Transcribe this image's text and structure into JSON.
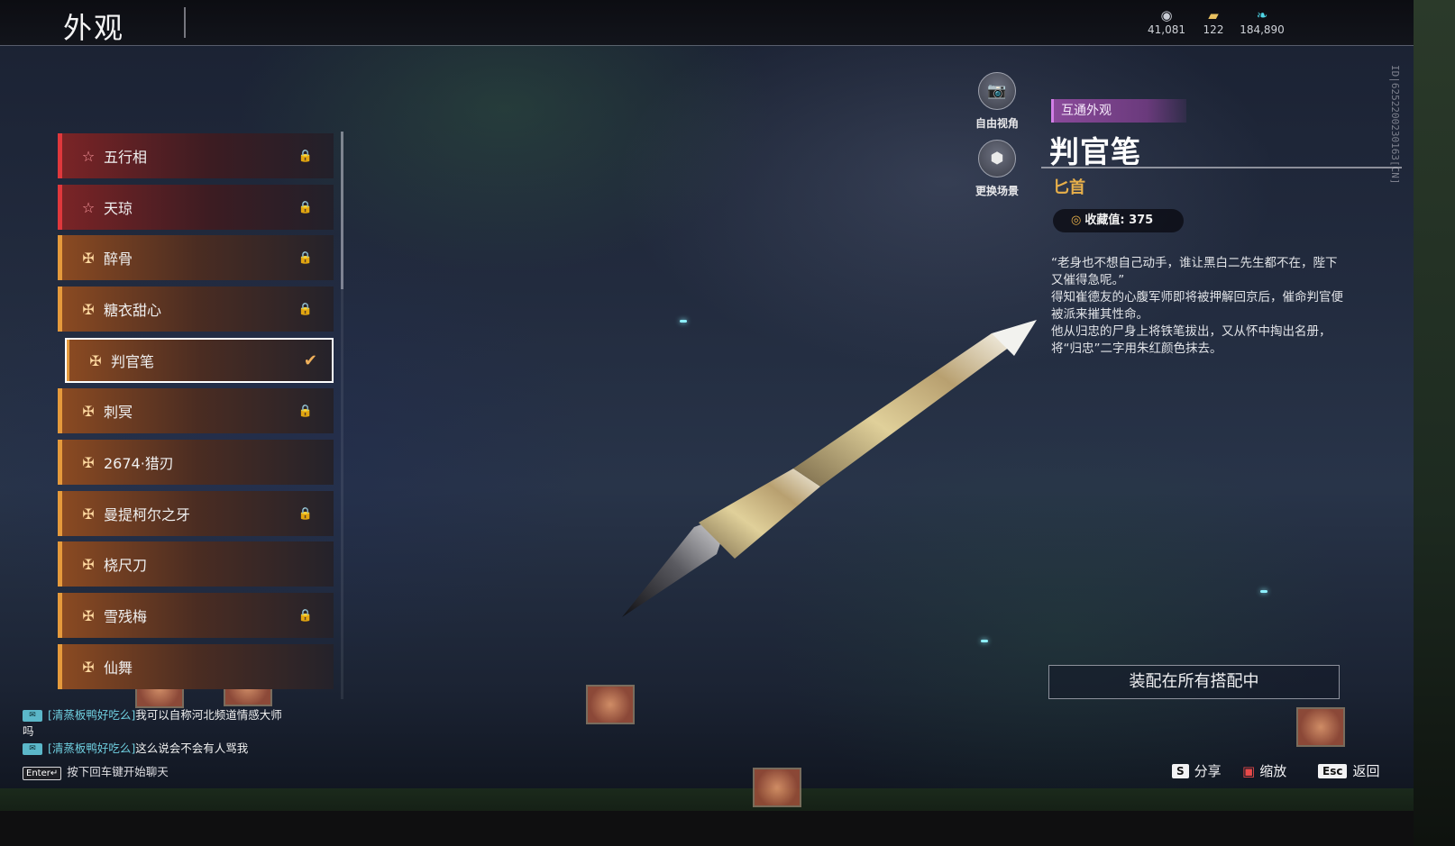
{
  "header": {
    "title": "外观",
    "currencies": [
      {
        "icon": "coin-icon",
        "value": "41,081"
      },
      {
        "icon": "ticket-icon",
        "value": "122"
      },
      {
        "icon": "feather-icon",
        "value": "184,890"
      }
    ]
  },
  "list": {
    "items": [
      {
        "name": "五行相",
        "quality": "red",
        "icon": "star-icon",
        "locked": true,
        "selected": false
      },
      {
        "name": "天琼",
        "quality": "red",
        "icon": "star-icon",
        "locked": true,
        "selected": false
      },
      {
        "name": "醉骨",
        "quality": "gold",
        "icon": "cross-ornament-icon",
        "locked": true,
        "selected": false
      },
      {
        "name": "糖衣甜心",
        "quality": "gold",
        "icon": "cross-ornament-icon",
        "locked": true,
        "selected": false
      },
      {
        "name": "判官笔",
        "quality": "gold",
        "icon": "cross-ornament-icon",
        "locked": false,
        "selected": true
      },
      {
        "name": "刺冥",
        "quality": "gold",
        "icon": "cross-ornament-icon",
        "locked": true,
        "selected": false
      },
      {
        "name": "2674·猎刃",
        "quality": "gold",
        "icon": "cross-ornament-icon",
        "locked": false,
        "selected": false
      },
      {
        "name": "曼提柯尔之牙",
        "quality": "gold",
        "icon": "cross-ornament-icon",
        "locked": true,
        "selected": false
      },
      {
        "name": "桡尺刀",
        "quality": "gold",
        "icon": "cross-ornament-icon",
        "locked": false,
        "selected": false
      },
      {
        "name": "雪残梅",
        "quality": "gold",
        "icon": "cross-ornament-icon",
        "locked": true,
        "selected": false
      },
      {
        "name": "仙舞",
        "quality": "gold",
        "icon": "cross-ornament-icon",
        "locked": false,
        "selected": false
      }
    ]
  },
  "camera": {
    "free_view": "自由视角",
    "change_scene": "更换场景"
  },
  "detail": {
    "tag": "互通外观",
    "name": "判官笔",
    "type": "匕首",
    "collect_label": "收藏值: 375",
    "description": [
      "“老身也不想自己动手，谁让黑白二先生都不在，陛下又催得急呢。”",
      "得知崔德友的心腹军师即将被押解回京后，催命判官便被派来摧其性命。",
      "他从归忠的尸身上将铁笔拔出，又从怀中掏出名册，将“归忠”二字用朱红颜色抹去。"
    ],
    "equip_button": "装配在所有搭配中"
  },
  "build_id": "ID|6252200230163[CN]",
  "chat": {
    "messages": [
      {
        "sender": "[清蒸板鸭好吃么]",
        "text": "我可以自称河北频道情感大师吗"
      },
      {
        "sender": "[清蒸板鸭好吃么]",
        "text": "这么说会不会有人骂我"
      }
    ],
    "hint_key": "Enter↵",
    "hint": "按下回车键开始聊天"
  },
  "footer": {
    "share_key": "S",
    "share": "分享",
    "zoom": "缩放",
    "back_key": "Esc",
    "back": "返回"
  }
}
